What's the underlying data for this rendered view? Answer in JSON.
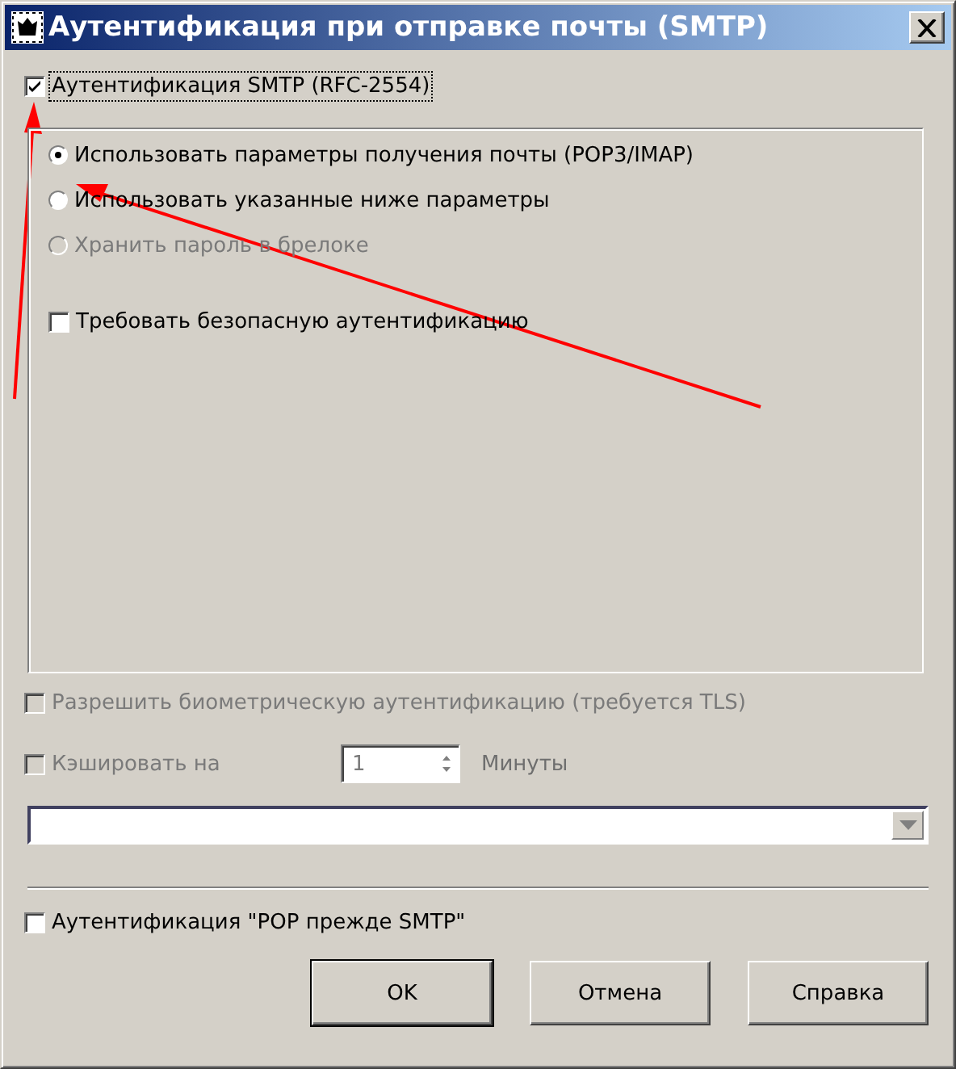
{
  "window": {
    "title": "Аутентификация при отправке почты (SMTP)"
  },
  "smtp_auth": {
    "label": "Аутентификация SMTP (RFC-2554)",
    "checked": true
  },
  "group_options": [
    {
      "kind": "radio",
      "label": "Использовать параметры получения почты (POP3/IMAP)",
      "selected": true,
      "disabled": false
    },
    {
      "kind": "radio",
      "label": "Использовать указанные ниже параметры",
      "selected": false,
      "disabled": false
    },
    {
      "kind": "radio",
      "label": "Хранить пароль в брелоке",
      "selected": false,
      "disabled": true
    },
    {
      "kind": "checkbox",
      "label": "Требовать безопасную аутентификацию",
      "checked": false,
      "disabled": false
    }
  ],
  "biometric": {
    "label": "Разрешить биометрическую аутентификацию (требуется TLS)",
    "checked": false,
    "disabled": true
  },
  "cache": {
    "label": "Кэшировать на",
    "checked": false,
    "disabled": true,
    "minutes": "1",
    "unit": "Минуты"
  },
  "pop_before_smtp": {
    "label": "Аутентификация \"POP прежде SMTP\"",
    "checked": false
  },
  "buttons": [
    {
      "label": "OK",
      "default": true
    },
    {
      "label": "Отмена",
      "default": false
    },
    {
      "label": "Справка",
      "default": false
    }
  ]
}
